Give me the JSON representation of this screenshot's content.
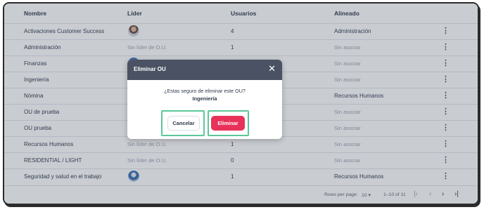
{
  "table": {
    "headers": {
      "name": "Nombre",
      "leader": "Líder",
      "users": "Usuarios",
      "aligned": "Alineado"
    },
    "rows": [
      {
        "name": "Activaciones Customer Success",
        "leader": "",
        "leader_avatar": "avatar-woman",
        "users": "4",
        "aligned": "Administración",
        "aligned_muted": false
      },
      {
        "name": "Administración",
        "leader": "Sin líder de O.U.",
        "users": "1",
        "aligned": "Sin asociar",
        "aligned_muted": true
      },
      {
        "name": "Finanzas",
        "leader": "",
        "leader_avatar": "avatar-blue",
        "users": "",
        "aligned": "Sin asociar",
        "aligned_muted": true
      },
      {
        "name": "Ingeniería",
        "leader": "",
        "users": "",
        "aligned": "Sin asociar",
        "aligned_muted": true
      },
      {
        "name": "Nómina",
        "leader": "",
        "users": "",
        "aligned": "Recursos Humanos",
        "aligned_muted": false
      },
      {
        "name": "OU de prueba",
        "leader": "",
        "users": "",
        "aligned": "Sin asociar",
        "aligned_muted": true
      },
      {
        "name": "OU prueba",
        "leader": "",
        "users": "",
        "aligned": "Sin asociar",
        "aligned_muted": true
      },
      {
        "name": "Recursos Humanos",
        "leader": "Sin líder de O.U.",
        "users": "1",
        "aligned": "Sin asociar",
        "aligned_muted": true
      },
      {
        "name": "RESIDENTIAL / LIGHT",
        "leader": "Sin líder de O.U.",
        "users": "0",
        "aligned": "Sin asociar",
        "aligned_muted": true
      },
      {
        "name": "Seguridad y salud en el trabajo",
        "leader": "",
        "leader_avatar": "avatar-man",
        "users": "1",
        "aligned": "Recursos Humanos",
        "aligned_muted": false
      }
    ],
    "row_menu_icon": "⋮"
  },
  "pagination": {
    "rows_per_page_label": "Rows per page:",
    "rows_per_page_value": "10",
    "range": "1–10 of 11",
    "first_icon": "|‹",
    "prev_icon": "‹",
    "next_icon": "›",
    "last_icon": "›|"
  },
  "modal": {
    "title": "Eliminar OU",
    "close_icon": "✕",
    "question": "¿Estas seguro de eliminar este OU?",
    "ou_name": "Ingeniería",
    "cancel_label": "Cancelar",
    "delete_label": "Eliminar"
  },
  "colors": {
    "modal_header": "#4a5263",
    "delete_button": "#e8325a",
    "highlight_outline": "#5bc79a"
  }
}
